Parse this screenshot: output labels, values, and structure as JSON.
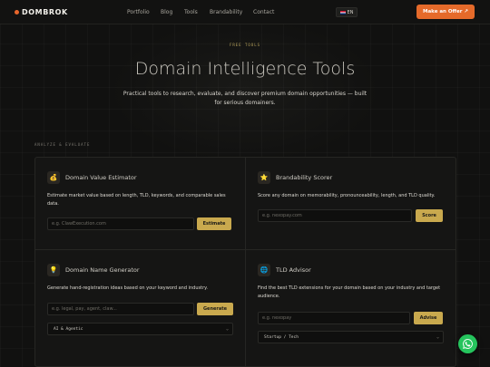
{
  "nav": {
    "logo": "DOMBROK",
    "links": [
      "Portfolio",
      "Blog",
      "Tools",
      "Brandability",
      "Contact"
    ],
    "lang": "EN",
    "cta": "Make an Offer ↗"
  },
  "hero": {
    "eyebrow": "FREE TOOLS",
    "title": "Domain Intelligence Tools",
    "subtitle": "Practical tools to research, evaluate, and discover premium domain opportunities — built for serious domainers."
  },
  "section": {
    "label": "ANALYZE & EVALUATE"
  },
  "tools": {
    "value": {
      "icon": "money-bag-icon",
      "title": "Domain Value Estimator",
      "desc": "Estimate market value based on length, TLD, keywords, and comparable sales data.",
      "placeholder": "e.g. ClawExecution.com",
      "button": "Estimate"
    },
    "brand": {
      "icon": "star-icon",
      "title": "Brandability Scorer",
      "desc": "Score any domain on memorability, pronounceability, length, and TLD quality.",
      "placeholder": "e.g. nexopay.com",
      "button": "Score"
    },
    "name": {
      "icon": "lightbulb-icon",
      "title": "Domain Name Generator",
      "desc": "Generate hand-registration ideas based on your keyword and industry.",
      "placeholder": "e.g. legal, pay, agent, claw...",
      "button": "Generate",
      "select": "AI & Agentic"
    },
    "tld": {
      "icon": "globe-icon",
      "title": "TLD Advisor",
      "desc": "Find the best TLD extensions for your domain based on your industry and target audience.",
      "placeholder": "e.g. nexopay",
      "button": "Advise",
      "select": "Startup / Tech"
    }
  },
  "colors": {
    "accent": "#e56a2a",
    "gold": "#c9a94e",
    "whatsapp": "#25c45d"
  }
}
